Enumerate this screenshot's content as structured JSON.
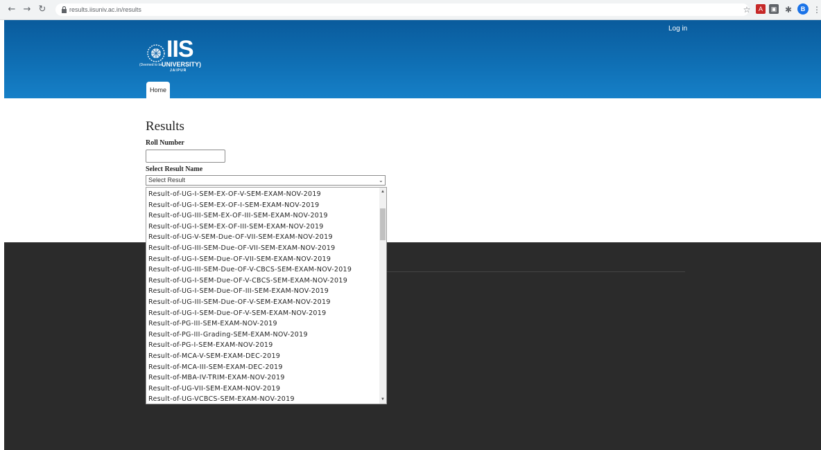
{
  "browser": {
    "url": "results.iisuniv.ac.in/results",
    "profile_initial": "B"
  },
  "header": {
    "login_label": "Log in",
    "logo_text": "IIS",
    "logo_deemed": "(Deemed to be",
    "logo_university": "UNIVERSITY)",
    "logo_city": "JAIPUR",
    "nav_home": "Home"
  },
  "form": {
    "title": "Results",
    "roll_label": "Roll Number",
    "roll_value": "",
    "result_label": "Select Result Name",
    "result_selected": "Select Result"
  },
  "dropdown": {
    "options": [
      "Result-of-UG-I-SEM-EX-OF-V-SEM-EXAM-NOV-2019",
      "Result-of-UG-I-SEM-EX-OF-I-SEM-EXAM-NOV-2019",
      "Result-of-UG-III-SEM-EX-OF-III-SEM-EXAM-NOV-2019",
      "Result-of-UG-I-SEM-EX-OF-III-SEM-EXAM-NOV-2019",
      "Result-of-UG-V-SEM-Due-OF-VII-SEM-EXAM-NOV-2019",
      "Result-of-UG-III-SEM-Due-OF-VII-SEM-EXAM-NOV-2019",
      "Result-of-UG-I-SEM-Due-OF-VII-SEM-EXAM-NOV-2019",
      "Result-of-UG-III-SEM-Due-OF-V-CBCS-SEM-EXAM-NOV-2019",
      "Result-of-UG-I-SEM-Due-OF-V-CBCS-SEM-EXAM-NOV-2019",
      "Result-of-UG-I-SEM-Due-OF-III-SEM-EXAM-NOV-2019",
      "Result-of-UG-III-SEM-Due-OF-V-SEM-EXAM-NOV-2019",
      "Result-of-UG-I-SEM-Due-OF-V-SEM-EXAM-NOV-2019",
      "Result-of-PG-III-SEM-EXAM-NOV-2019",
      "Result-of-PG-III-Grading-SEM-EXAM-NOV-2019",
      "Result-of-PG-I-SEM-EXAM-NOV-2019",
      "Result-of-MCA-V-SEM-EXAM-DEC-2019",
      "Result-of-MCA-III-SEM-EXAM-DEC-2019",
      "Result-of-MBA-IV-TRIM-EXAM-NOV-2019",
      "Result-of-UG-VII-SEM-EXAM-NOV-2019",
      "Result-of-UG-VCBCS-SEM-EXAM-NOV-2019"
    ]
  },
  "colors": {
    "header_top": "#0a5b9c",
    "header_bottom": "#1680c8",
    "footer": "#2b2b2b"
  }
}
